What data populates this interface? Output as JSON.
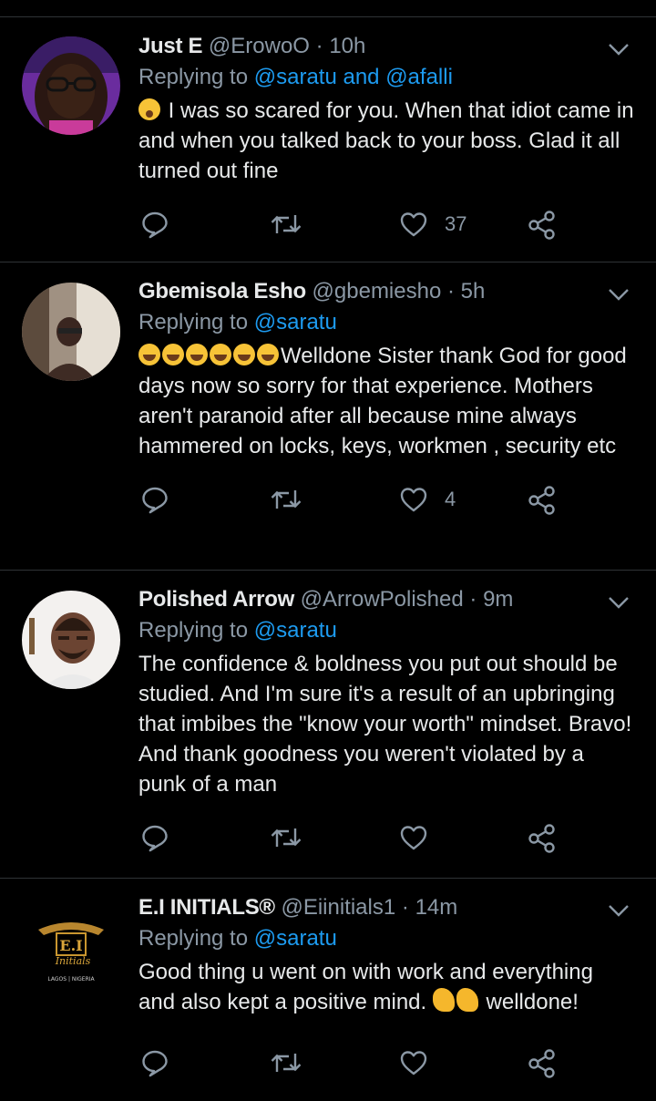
{
  "tweets": [
    {
      "name": "Just E",
      "handle": "@ErowoO",
      "dot": "·",
      "time": "10h",
      "reply_prefix": "Replying to",
      "mentions": "@saratu and @afalli",
      "text": "I was so scared for you. When that idiot came in and when you talked back to your boss. Glad it all turned out fine",
      "likes": "37"
    },
    {
      "name": "Gbemisola Esho",
      "handle": "@gbemiesho",
      "dot": "·",
      "time": "5h",
      "reply_prefix": "Replying to",
      "mentions": "@saratu",
      "text": "Welldone Sister thank God for good days now so sorry for that experience. Mothers aren't paranoid after all because mine always hammered on locks, keys, workmen , security etc",
      "likes": "4"
    },
    {
      "name": "Polished Arrow",
      "handle": "@ArrowPolished",
      "dot": "·",
      "time": "9m",
      "reply_prefix": "Replying to",
      "mentions": "@saratu",
      "text": "The confidence & boldness you put out should be studied. And I'm sure it's a result of an upbringing that imbibes the \"know your worth\" mindset. Bravo! And thank goodness you weren't violated by a punk of a man",
      "likes": ""
    },
    {
      "name": "E.I INITIALS®",
      "handle": "@Eiinitials1",
      "dot": "·",
      "time": "14m",
      "reply_prefix": "Replying to",
      "mentions": "@saratu",
      "text": "Good thing u went on with work and everything and also kept a positive mind.",
      "text_tail": "welldone!",
      "logo_text": "E.I",
      "logo_script": "Initials",
      "logo_caption": "LAGOS | NIGERIA",
      "likes": ""
    }
  ],
  "colors": {
    "background": "#000000",
    "text": "#e7e9ea",
    "secondary": "#8b98a5",
    "mention": "#1d9bf0",
    "divider": "#2f3336"
  },
  "icons": [
    "chevron-down-icon",
    "reply-icon",
    "retweet-icon",
    "like-icon",
    "share-icon"
  ]
}
